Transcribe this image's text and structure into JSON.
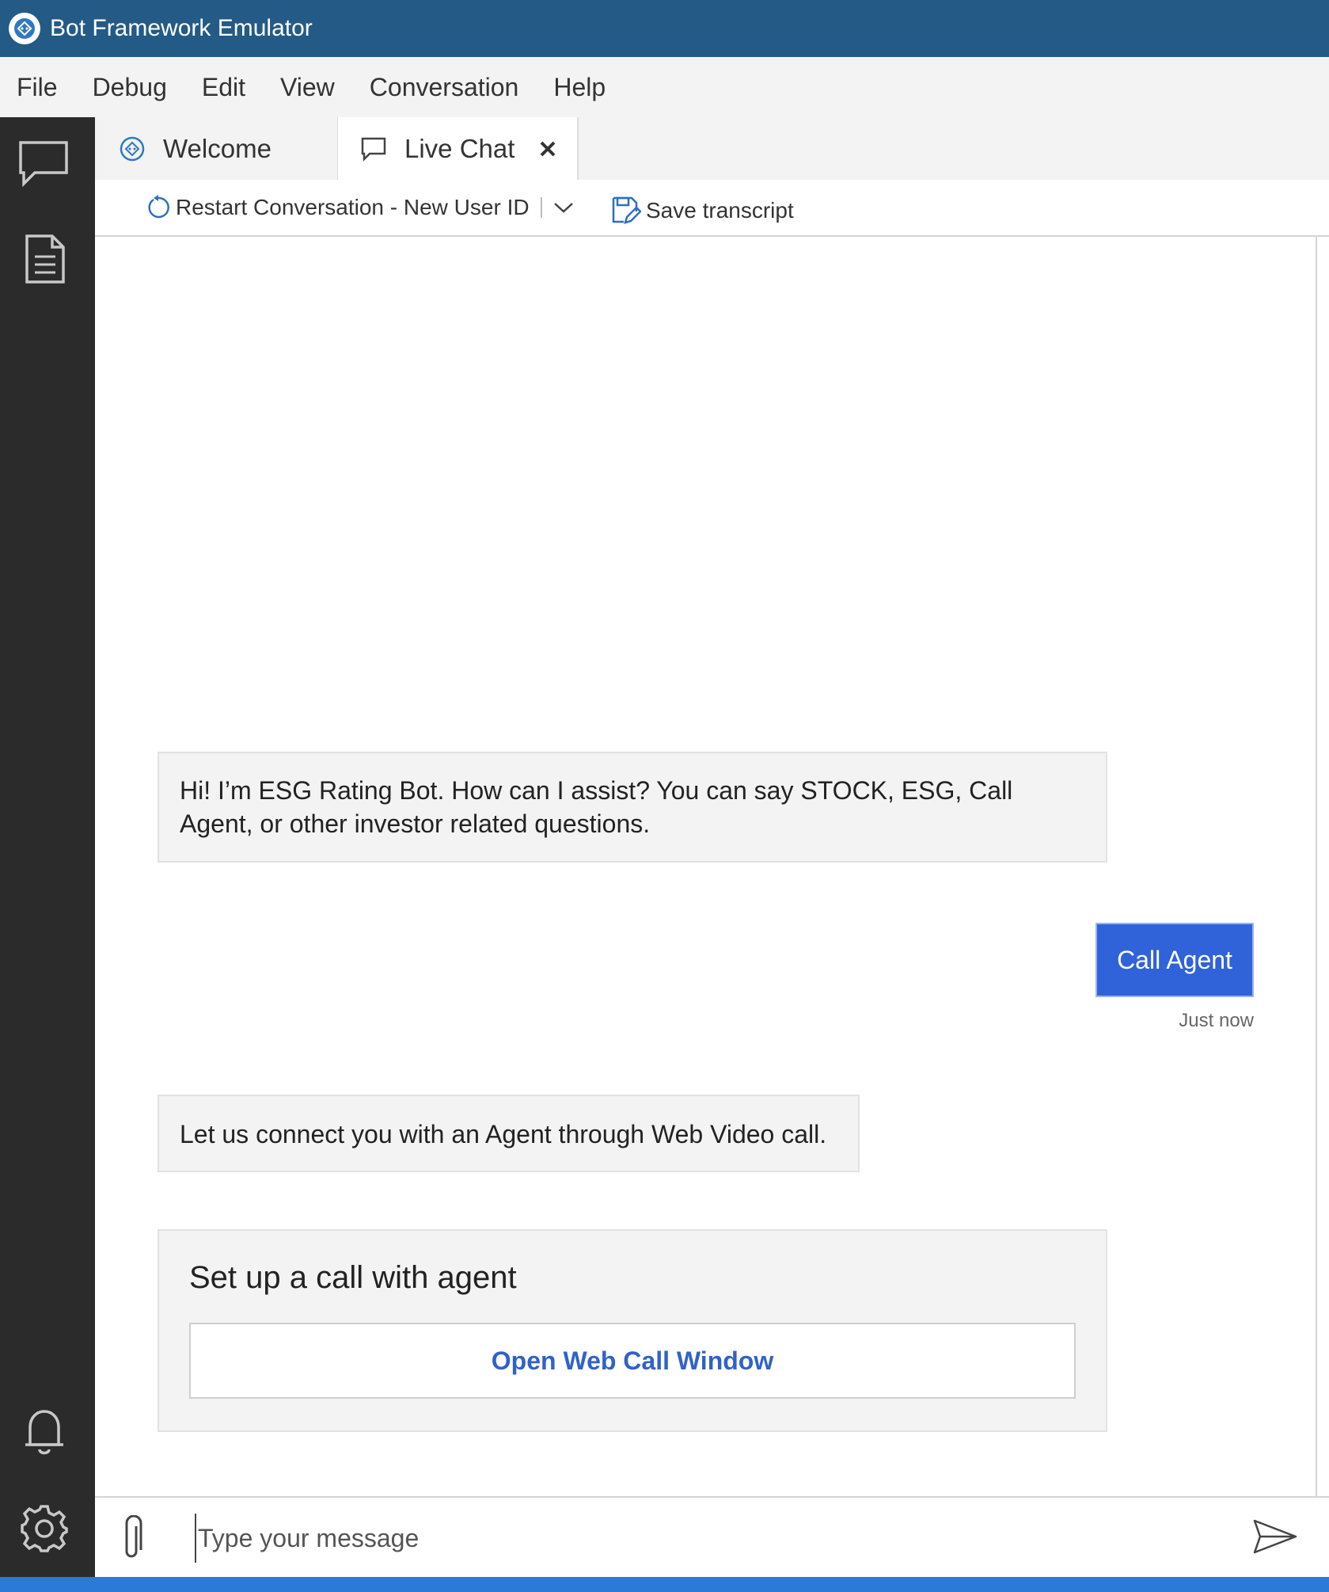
{
  "app": {
    "title": "Bot Framework Emulator"
  },
  "menu": [
    "File",
    "Debug",
    "Edit",
    "View",
    "Conversation",
    "Help"
  ],
  "tabs": [
    {
      "label": "Welcome",
      "icon": "emulator-logo-icon"
    },
    {
      "label": "Live Chat",
      "icon": "chat-bubble-icon",
      "active": true
    }
  ],
  "toolbar": {
    "restart_label": "Restart Conversation - New User ID",
    "save_label": "Save transcript"
  },
  "messages": [
    {
      "from": "bot",
      "text": "Hi! I’m ESG Rating Bot. How can I assist? You can say STOCK, ESG, Call Agent, or other investor related questions."
    },
    {
      "from": "user",
      "text": "Call Agent",
      "timestamp": "Just now"
    },
    {
      "from": "bot",
      "text": "Let us connect you with an Agent through Web Video call."
    }
  ],
  "card": {
    "title": "Set up a call with agent",
    "button_label": "Open Web Call Window"
  },
  "composer": {
    "placeholder": "Type your message"
  },
  "colors": {
    "titlebar": "#235b86",
    "accent": "#3062d9",
    "link": "#3062c8",
    "sidebar": "#2b2b2b",
    "statusbar": "#2b7bd6"
  }
}
